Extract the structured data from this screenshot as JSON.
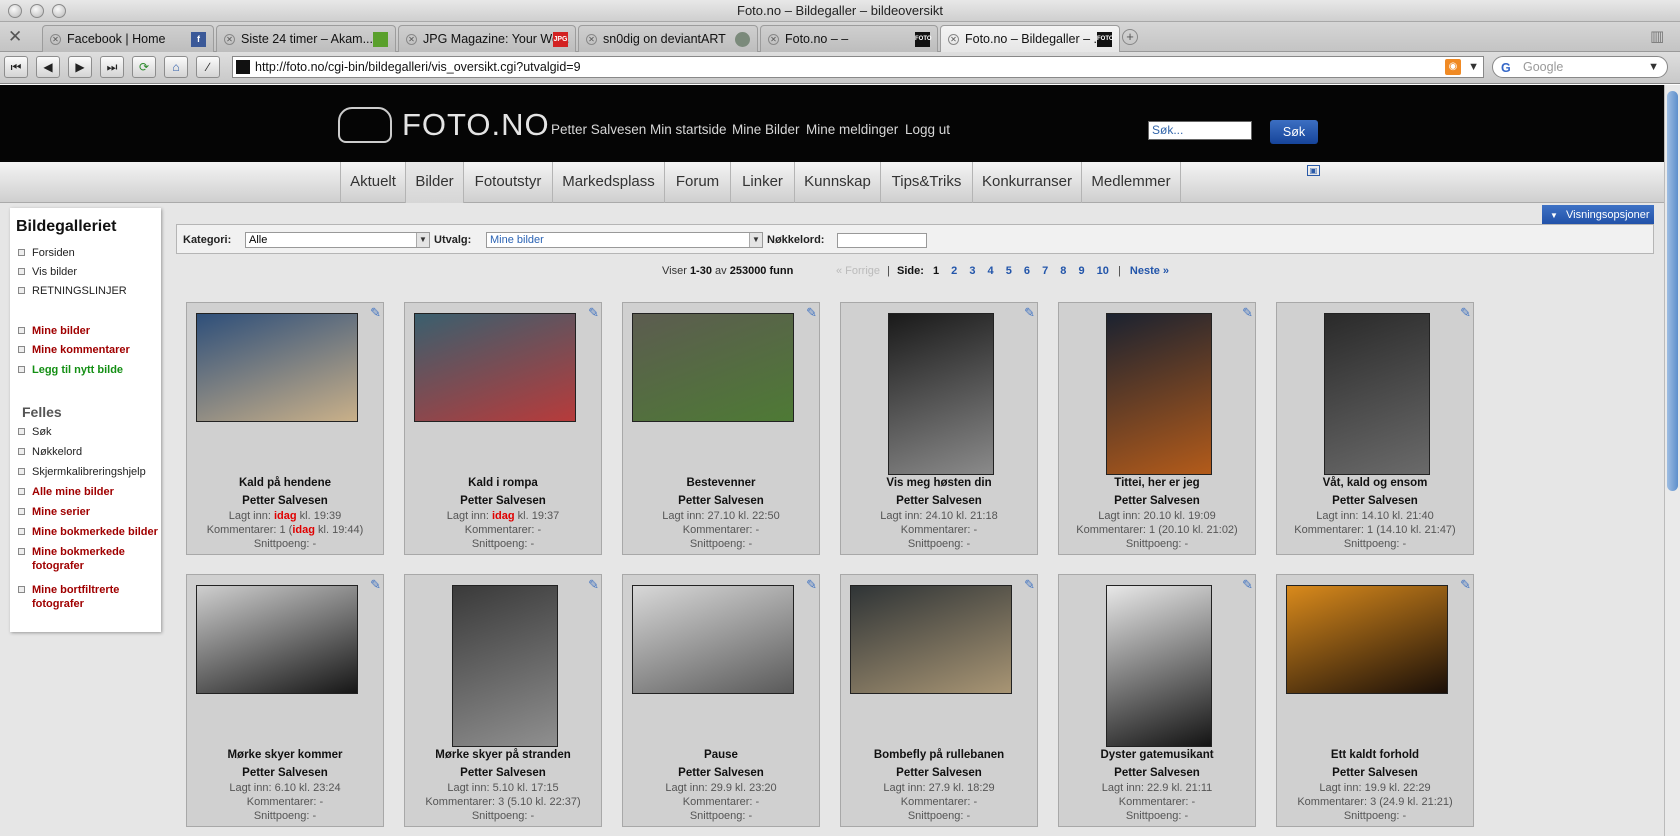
{
  "window": {
    "title": "Foto.no – Bildegaller – bildeoversikt"
  },
  "tabs": [
    {
      "title": "Facebook | Home",
      "fav": "f",
      "color": "#3b5998"
    },
    {
      "title": "Siste 24 timer – Akam....",
      "fav": "",
      "color": "#5aa02c"
    },
    {
      "title": "JPG Magazine: Your Wo...",
      "fav": "JPG",
      "color": "#d32222"
    },
    {
      "title": "sn0dig on deviantART",
      "fav": "",
      "color": "#7b8a7b"
    },
    {
      "title": "Foto.no – –",
      "fav": "FOTO",
      "color": "#111111"
    },
    {
      "title": "Foto.no – Bildegaller – ...",
      "fav": "FOTO",
      "color": "#111111"
    }
  ],
  "url": "http://foto.no/cgi-bin/bildegalleri/vis_oversikt.cgi?utvalgid=9",
  "browser_search": "Google",
  "site": {
    "logo": "FOTO.NO",
    "header_links": [
      "Petter Salvesen",
      "Min startside",
      "Mine Bilder",
      "Mine meldinger",
      "Logg ut"
    ],
    "search_placeholder": "Søk...",
    "search_button": "Søk"
  },
  "nav": [
    "Aktuelt",
    "Bilder",
    "Fotoutstyr",
    "Markedsplass",
    "Forum",
    "Linker",
    "Kunnskap",
    "Tips&Triks",
    "Konkurranser",
    "Medlemmer"
  ],
  "sidebar": {
    "title": "Bildegalleriet",
    "group1": [
      "Forsiden",
      "Vis bilder",
      "RETNINGSLINJER"
    ],
    "group2": [
      "Mine bilder",
      "Mine kommentarer"
    ],
    "add": "Legg til nytt bilde",
    "felles_title": "Felles",
    "felles": [
      "Søk",
      "Nøkkelord",
      "Skjermkalibreringshjelp"
    ],
    "felles_red": [
      "Alle mine bilder",
      "Mine serier",
      "Mine bokmerkede bilder",
      "Mine bokmerkede fotografer",
      "Mine bortfiltrerte fotografer"
    ]
  },
  "filter": {
    "kategori_label": "Kategori:",
    "kategori_value": "Alle",
    "utvalg_label": "Utvalg:",
    "utvalg_value": "Mine bilder",
    "nokkel_label": "Nøkkelord:"
  },
  "visning": "Visningsopsjoner",
  "pager": {
    "viser": "Viser",
    "range": "1-30",
    "av": "av",
    "total": "253000",
    "funn": "funn",
    "prev": "« Forrige",
    "side": "Side:",
    "current": "1",
    "pages": [
      "2",
      "3",
      "4",
      "5",
      "6",
      "7",
      "8",
      "9",
      "10"
    ],
    "next": "Neste »"
  },
  "labels": {
    "lagt": "Lagt inn:",
    "komm": "Kommentarer:",
    "snitt": "Snittpoeng: -",
    "idag": "idag"
  },
  "cards": [
    {
      "title": "Kald på hendene",
      "author": "Petter Salvesen",
      "lagt_today": true,
      "lagt": "kl. 19:39",
      "komm_pre": "1 (",
      "komm_today": true,
      "komm": "kl. 19:44)",
      "shape": "land",
      "c1": "#2e4f7a",
      "c2": "#c9b089"
    },
    {
      "title": "Kald i rompa",
      "author": "Petter Salvesen",
      "lagt_today": true,
      "lagt": "kl. 19:37",
      "komm_pre": "",
      "komm_today": false,
      "komm": "-",
      "shape": "land",
      "c1": "#3a5f6e",
      "c2": "#b73b3b"
    },
    {
      "title": "Bestevenner",
      "author": "Petter Salvesen",
      "lagt_today": false,
      "lagt": "27.10 kl. 22:50",
      "komm_pre": "",
      "komm_today": false,
      "komm": "-",
      "shape": "land",
      "c1": "#5c5c50",
      "c2": "#4e7a35"
    },
    {
      "title": "Vis meg høsten din",
      "author": "Petter Salvesen",
      "lagt_today": false,
      "lagt": "24.10 kl. 21:18",
      "komm_pre": "",
      "komm_today": false,
      "komm": "-",
      "shape": "port",
      "c1": "#1a1a1a",
      "c2": "#8a8a8a"
    },
    {
      "title": "Tittei, her er jeg",
      "author": "Petter Salvesen",
      "lagt_today": false,
      "lagt": "20.10 kl. 19:09",
      "komm_pre": "",
      "komm_today": false,
      "komm": "1 (20.10 kl. 21:02)",
      "shape": "port",
      "c1": "#1b2230",
      "c2": "#b35b1a"
    },
    {
      "title": "Våt, kald og ensom",
      "author": "Petter Salvesen",
      "lagt_today": false,
      "lagt": "14.10 kl. 21:40",
      "komm_pre": "",
      "komm_today": false,
      "komm": "1 (14.10 kl. 21:47)",
      "shape": "port",
      "c1": "#2a2a2a",
      "c2": "#6a6a6a"
    },
    {
      "title": "Mørke skyer kommer",
      "author": "Petter Salvesen",
      "lagt_today": false,
      "lagt": "6.10 kl. 23:24",
      "komm_pre": "",
      "komm_today": false,
      "komm": "-",
      "shape": "land",
      "c1": "#cfcfcf",
      "c2": "#161616"
    },
    {
      "title": "Mørke skyer på stranden",
      "author": "Petter Salvesen",
      "lagt_today": false,
      "lagt": "5.10 kl. 17:15",
      "komm_pre": "",
      "komm_today": false,
      "komm": "3 (5.10 kl. 22:37)",
      "shape": "port",
      "c1": "#3a3a3a",
      "c2": "#8f8f8f"
    },
    {
      "title": "Pause",
      "author": "Petter Salvesen",
      "lagt_today": false,
      "lagt": "29.9 kl. 23:20",
      "komm_pre": "",
      "komm_today": false,
      "komm": "-",
      "shape": "land",
      "c1": "#d8d8d8",
      "c2": "#5a5a5a"
    },
    {
      "title": "Bombefly på rullebanen",
      "author": "Petter Salvesen",
      "lagt_today": false,
      "lagt": "27.9 kl. 18:29",
      "komm_pre": "",
      "komm_today": false,
      "komm": "-",
      "shape": "land",
      "c1": "#2f3436",
      "c2": "#a89574"
    },
    {
      "title": "Dyster gatemusikant",
      "author": "Petter Salvesen",
      "lagt_today": false,
      "lagt": "22.9 kl. 21:11",
      "komm_pre": "",
      "komm_today": false,
      "komm": "-",
      "shape": "port",
      "c1": "#e8e8e8",
      "c2": "#141414"
    },
    {
      "title": "Ett kaldt forhold",
      "author": "Petter Salvesen",
      "lagt_today": false,
      "lagt": "19.9 kl. 22:29",
      "komm_pre": "",
      "komm_today": false,
      "komm": "3 (24.9 kl. 21:21)",
      "shape": "land",
      "c1": "#d98a1c",
      "c2": "#1a0f08"
    }
  ]
}
